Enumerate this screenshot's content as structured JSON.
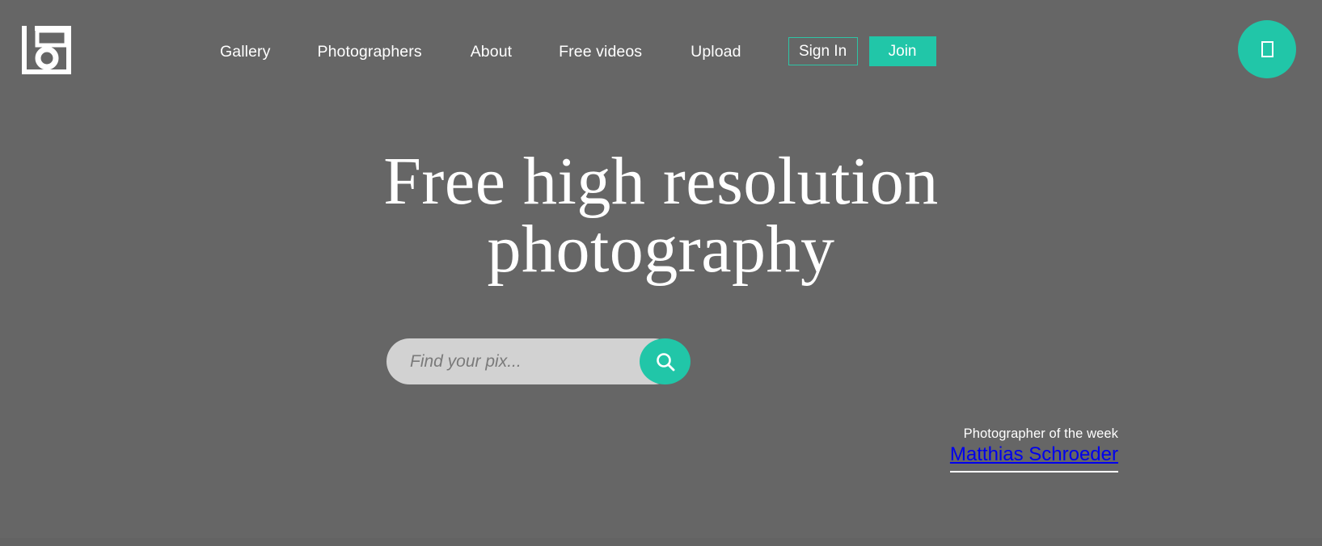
{
  "brand": {
    "logo_icon": "camera-floppy-logo-icon"
  },
  "colors": {
    "background": "#666666",
    "accent": "#21c6a8",
    "accent_border": "#2ec4a5",
    "search_field": "#d2d2d2",
    "text": "#ffffff",
    "placeholder_text": "#7a7a7a"
  },
  "nav": {
    "links": [
      {
        "label": "Gallery",
        "name": "nav-link-gallery"
      },
      {
        "label": "Photographers",
        "name": "nav-link-photographers"
      },
      {
        "label": "About",
        "name": "nav-link-about"
      },
      {
        "label": "Free videos",
        "name": "nav-link-free-videos"
      },
      {
        "label": "Upload",
        "name": "nav-link-upload"
      }
    ],
    "sign_in_label": "Sign In",
    "join_label": "Join",
    "avatar_icon": "user-avatar-icon"
  },
  "hero": {
    "headline_line1": "Free high resolution",
    "headline_line2": "photography"
  },
  "search": {
    "placeholder": "Find your pix...",
    "value": "",
    "button_icon": "search-icon"
  },
  "photographer_of_week": {
    "label": "Photographer of the week",
    "name": "Matthias Schroeder"
  }
}
